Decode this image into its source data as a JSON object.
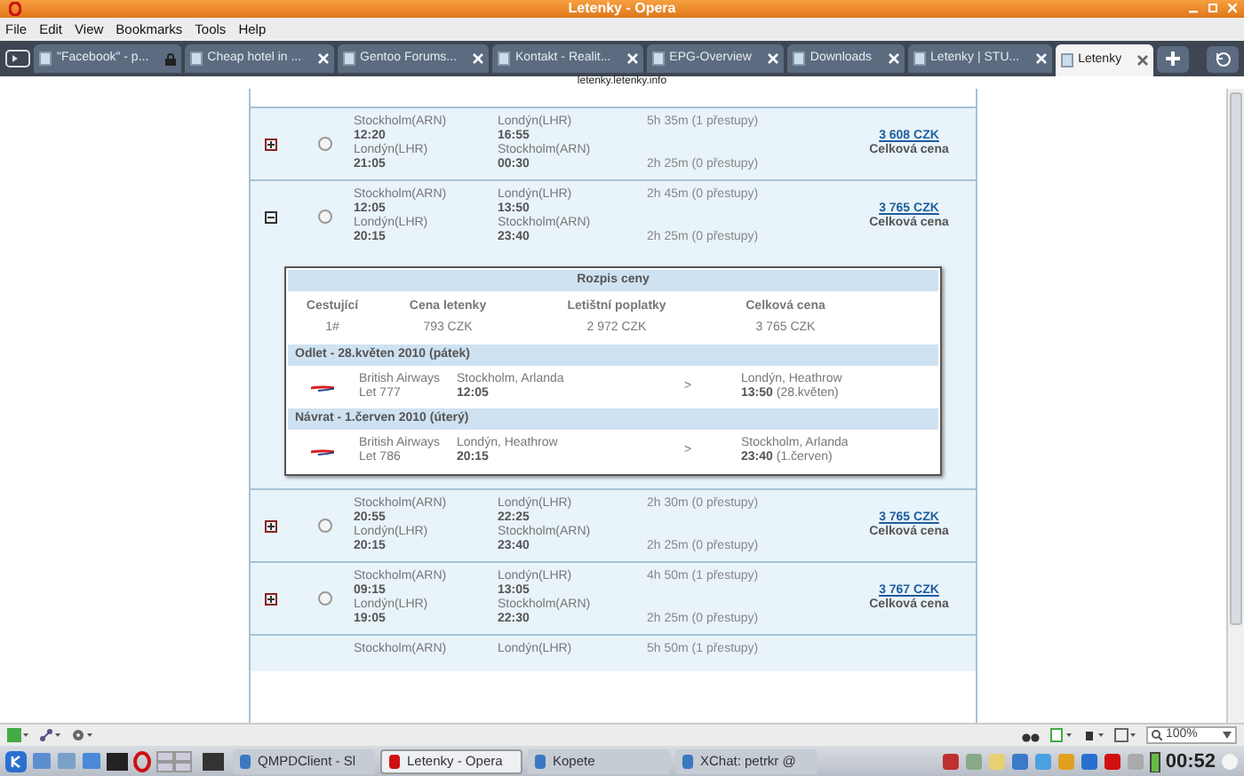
{
  "window": {
    "title": "Letenky - Opera"
  },
  "menu": [
    "File",
    "Edit",
    "View",
    "Bookmarks",
    "Tools",
    "Help"
  ],
  "tabs": [
    {
      "label": "\"Facebook\" - p...",
      "selected": false,
      "locked": true
    },
    {
      "label": "Cheap hotel in ...",
      "selected": false,
      "locked": false
    },
    {
      "label": "Gentoo Forums...",
      "selected": false,
      "locked": false
    },
    {
      "label": "Kontakt - Realit...",
      "selected": false,
      "locked": false
    },
    {
      "label": "EPG-Overview",
      "selected": false,
      "locked": false
    },
    {
      "label": "Downloads",
      "selected": false,
      "locked": false
    },
    {
      "label": "Letenky | STU...",
      "selected": false,
      "locked": false
    },
    {
      "label": "Letenky",
      "selected": true,
      "locked": false
    }
  ],
  "address": "letenky.letenky.info",
  "flights": [
    {
      "expanded": false,
      "selected": false,
      "outbound": {
        "from": "Stockholm(ARN)",
        "dep": "12:20",
        "to": "Londýn(LHR)",
        "arr": "16:55",
        "duration": "5h 35m (1 přestupy)"
      },
      "return": {
        "from": "Londýn(LHR)",
        "dep": "21:05",
        "to": "Stockholm(ARN)",
        "arr": "00:30",
        "duration": "2h 25m (0 přestupy)"
      },
      "price": "3 608 CZK",
      "price_label": "Celková cena"
    },
    {
      "expanded": true,
      "selected": false,
      "outbound": {
        "from": "Stockholm(ARN)",
        "dep": "12:05",
        "to": "Londýn(LHR)",
        "arr": "13:50",
        "duration": "2h 45m (0 přestupy)"
      },
      "return": {
        "from": "Londýn(LHR)",
        "dep": "20:15",
        "to": "Stockholm(ARN)",
        "arr": "23:40",
        "duration": "2h 25m (0 přestupy)"
      },
      "price": "3 765 CZK",
      "price_label": "Celková cena",
      "price_breakdown": {
        "title": "Rozpis ceny",
        "columns": [
          "Cestující",
          "Cena letenky",
          "Letištní poplatky",
          "Celková cena"
        ],
        "row": [
          "1#",
          "793 CZK",
          "2 972 CZK",
          "3 765 CZK"
        ],
        "segments": [
          {
            "heading": "Odlet  -  28.květen 2010 (pátek)",
            "airline": "British Airways",
            "flight": "Let 777",
            "from": "Stockholm, Arlanda",
            "dep": "12:05",
            "arrow": ">",
            "to": "Londýn, Heathrow",
            "arr": "13:50",
            "arr_note": "(28.květen)"
          },
          {
            "heading": "Návrat  -  1.červen 2010 (úterý)",
            "airline": "British Airways",
            "flight": "Let 786",
            "from": "Londýn, Heathrow",
            "dep": "20:15",
            "arrow": ">",
            "to": "Stockholm, Arlanda",
            "arr": "23:40",
            "arr_note": "(1.červen)"
          }
        ]
      }
    },
    {
      "expanded": false,
      "selected": false,
      "outbound": {
        "from": "Stockholm(ARN)",
        "dep": "20:55",
        "to": "Londýn(LHR)",
        "arr": "22:25",
        "duration": "2h 30m (0 přestupy)"
      },
      "return": {
        "from": "Londýn(LHR)",
        "dep": "20:15",
        "to": "Stockholm(ARN)",
        "arr": "23:40",
        "duration": "2h 25m (0 přestupy)"
      },
      "price": "3 765 CZK",
      "price_label": "Celková cena"
    },
    {
      "expanded": false,
      "selected": false,
      "outbound": {
        "from": "Stockholm(ARN)",
        "dep": "09:15",
        "to": "Londýn(LHR)",
        "arr": "13:05",
        "duration": "4h 50m (1 přestupy)"
      },
      "return": {
        "from": "Londýn(LHR)",
        "dep": "19:05",
        "to": "Stockholm(ARN)",
        "arr": "22:30",
        "duration": "2h 25m (0 přestupy)"
      },
      "price": "3 767 CZK",
      "price_label": "Celková cena"
    },
    {
      "outbound": {
        "from": "Stockholm(ARN)",
        "to": "Londýn(LHR)",
        "duration": "5h 50m (1 přestupy)"
      }
    }
  ],
  "status_bar": {
    "zoom": "100%"
  },
  "taskbar": {
    "tasks": [
      {
        "label": "QMPDClient - Sl",
        "selected": false
      },
      {
        "label": "Letenky - Opera",
        "selected": true
      },
      {
        "label": "Kopete",
        "selected": false
      },
      {
        "label": "XChat: petrkr @",
        "selected": false
      }
    ],
    "clock": "00:52"
  }
}
